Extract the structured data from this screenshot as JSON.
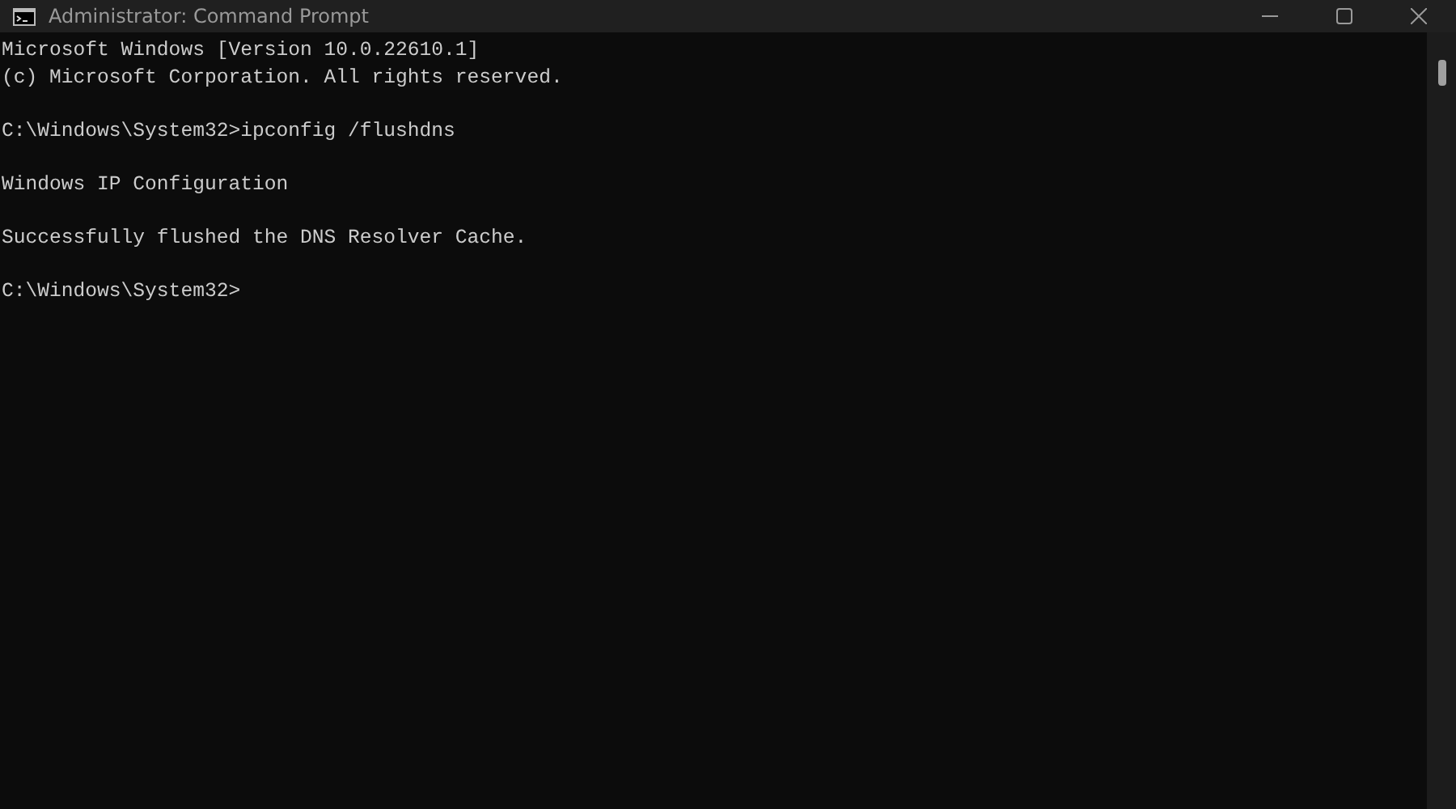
{
  "window": {
    "title": "Administrator: Command Prompt"
  },
  "console": {
    "blocks": [
      [
        "Microsoft Windows [Version 10.0.22610.1]",
        "(c) Microsoft Corporation. All rights reserved."
      ],
      [
        "C:\\Windows\\System32>ipconfig /flushdns"
      ],
      [
        "Windows IP Configuration"
      ],
      [
        "Successfully flushed the DNS Resolver Cache."
      ],
      [
        "C:\\Windows\\System32>"
      ]
    ]
  }
}
